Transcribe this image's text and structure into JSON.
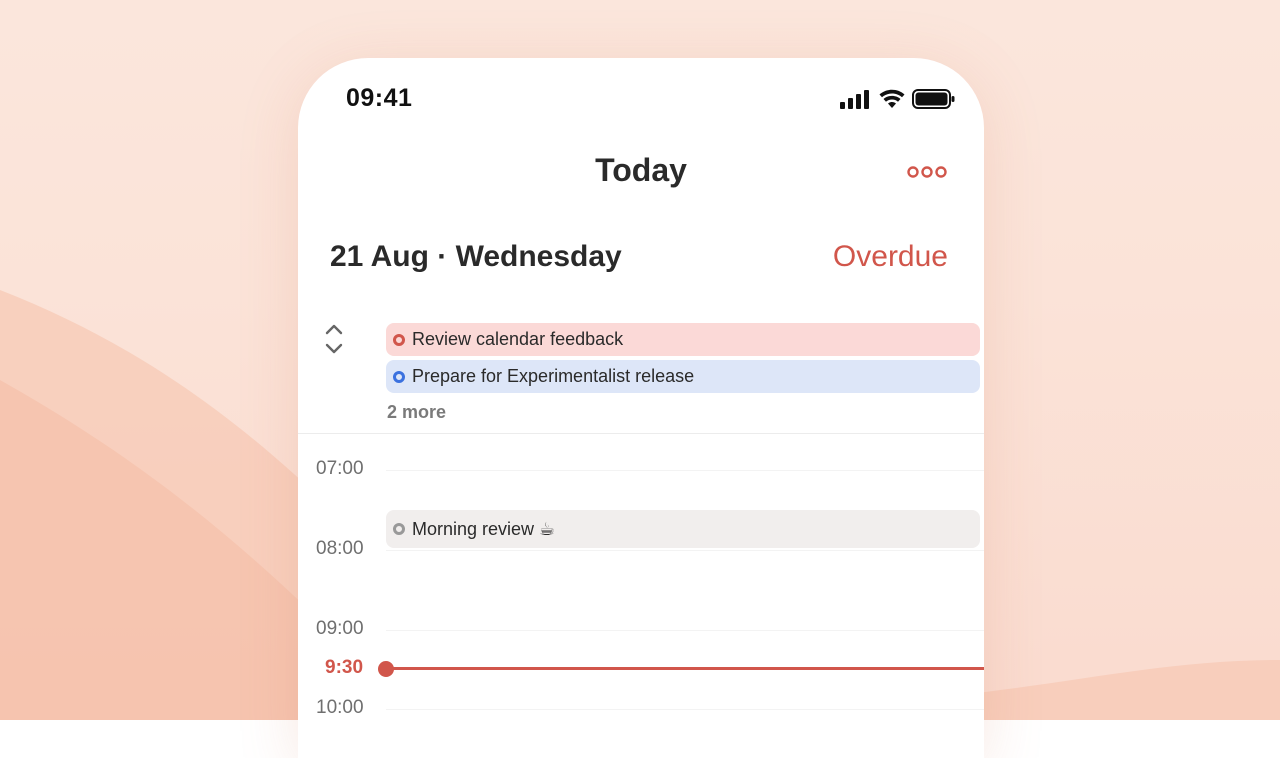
{
  "status_bar": {
    "time": "09:41",
    "icons": [
      "cellular-signal-icon",
      "wifi-icon",
      "battery-icon"
    ]
  },
  "header": {
    "title": "Today",
    "more_icon": "ellipsis-icon"
  },
  "date_row": {
    "date": "21 Aug · Wednesday",
    "overdue_label": "Overdue"
  },
  "all_day": {
    "collapse_icon": "chevron-up-down-icon",
    "tasks": [
      {
        "label": "Review calendar feedback",
        "color": "#d1564b",
        "background": "#fbd9d7"
      },
      {
        "label": "Prepare for Experimentalist release",
        "color": "#3b71df",
        "background": "#dde6f8"
      }
    ],
    "more_label": "2 more"
  },
  "timeline": {
    "hours": [
      "07:00",
      "08:00",
      "09:00",
      "10:00"
    ],
    "events": [
      {
        "label": "Morning review ☕",
        "color": "#999999",
        "background": "#f1eeed"
      }
    ],
    "now_label": "9:30"
  },
  "colors": {
    "accent": "#d1564b",
    "background": "#fbe6dc"
  }
}
